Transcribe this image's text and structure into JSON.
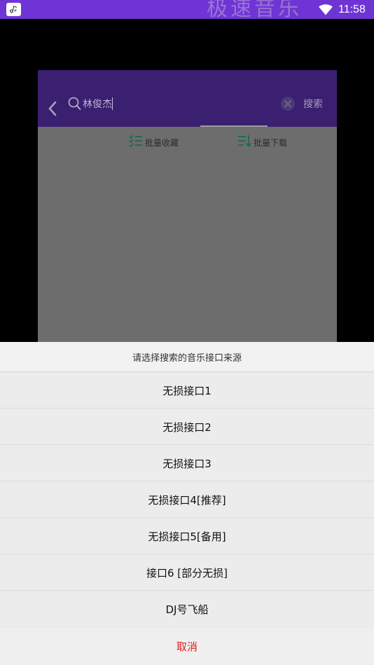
{
  "status_bar": {
    "time": "11:58",
    "ghost_text": "极速音乐",
    "app_icon": "music-note-icon",
    "wifi_icon": "wifi-icon"
  },
  "search_dialog": {
    "search_query": "林俊杰",
    "search_button_label": "搜索",
    "batch_collect_label": "批量收藏",
    "batch_download_label": "批量下载",
    "accent_color": "#3b1f70"
  },
  "source_sheet": {
    "title": "请选择搜索的音乐接口来源",
    "options": [
      {
        "label": "无损接口1"
      },
      {
        "label": "无损接口2"
      },
      {
        "label": "无损接口3"
      },
      {
        "label": "无损接口4[推荐]"
      },
      {
        "label": "无损接口5[备用]"
      },
      {
        "label": "接口6 [部分无损]"
      },
      {
        "label": "DJ号飞船"
      }
    ],
    "cancel_label": "取消",
    "cancel_color": "#e02020"
  }
}
